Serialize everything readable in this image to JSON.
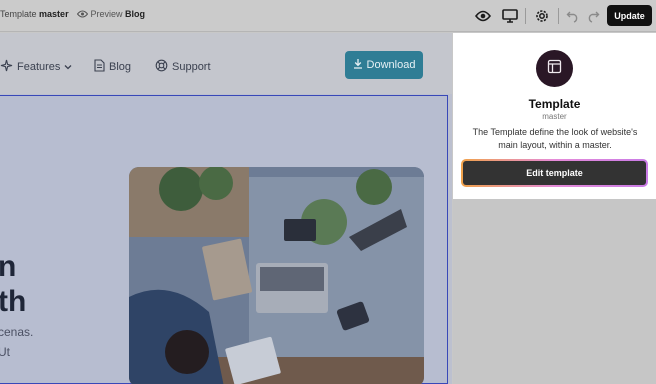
{
  "toolbar": {
    "breadcrumb_type": "Template",
    "breadcrumb_name": "master",
    "preview_label": "Preview",
    "preview_target": "Blog",
    "update_label": "Update"
  },
  "site": {
    "nav": [
      {
        "label": "Features",
        "icon": "sparkle-icon"
      },
      {
        "label": "Blog",
        "icon": "document-icon"
      },
      {
        "label": "Support",
        "icon": "lifebuoy-icon"
      }
    ],
    "download_label": "Download",
    "hero_heading_lines": [
      "n",
      "th"
    ],
    "hero_text_lines": [
      "cenas.",
      "Ut"
    ]
  },
  "panel": {
    "title": "Template",
    "subtitle": "master",
    "description": "The Template define the look of website's main layout, within a master.",
    "edit_label": "Edit template"
  },
  "colors": {
    "accent": "#2f7d95",
    "selection": "#3848b8",
    "update_bg": "#111111",
    "gradient": [
      "#f0a24a",
      "#e58bd9",
      "#c97be6"
    ]
  }
}
